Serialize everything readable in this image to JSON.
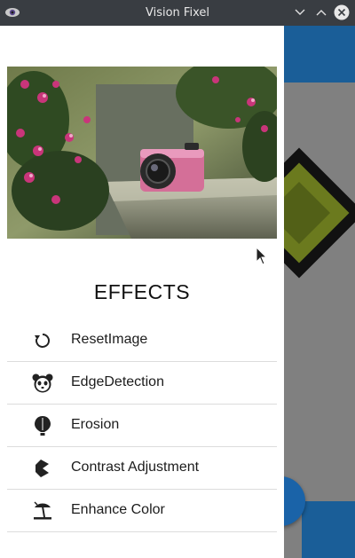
{
  "window": {
    "title": "Vision Fixel",
    "icons": {
      "app": "eye-app-icon",
      "minimize": "chevron-down-icon",
      "maximize": "chevron-up-icon",
      "close": "close-icon"
    }
  },
  "drawer": {
    "heading": "EFFECTS",
    "items": [
      {
        "label": "ResetImage",
        "icon": "reset-icon"
      },
      {
        "label": "EdgeDetection",
        "icon": "panda-icon"
      },
      {
        "label": "Erosion",
        "icon": "balloon-icon"
      },
      {
        "label": "Contrast Adjustment",
        "icon": "contrast-shape-icon"
      },
      {
        "label": "Enhance Color",
        "icon": "beach-umbrella-icon"
      }
    ]
  },
  "colors": {
    "titlebar": "#393d42",
    "primary": "#1a5e98",
    "scrim": "#808080",
    "shape_fill": "#6b7a1e",
    "shape_border": "#111111"
  }
}
